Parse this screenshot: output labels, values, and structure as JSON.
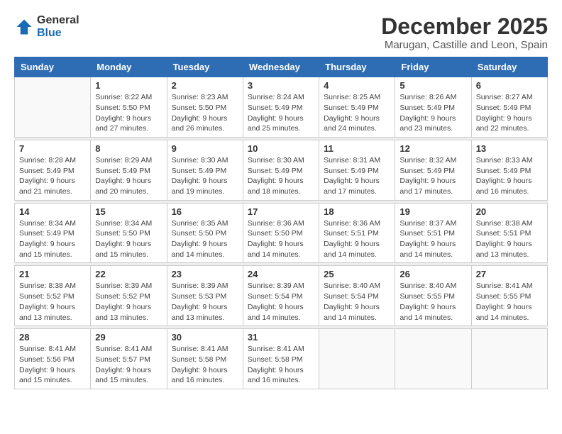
{
  "logo": {
    "general": "General",
    "blue": "Blue"
  },
  "title": "December 2025",
  "subtitle": "Marugan, Castille and Leon, Spain",
  "weekdays": [
    "Sunday",
    "Monday",
    "Tuesday",
    "Wednesday",
    "Thursday",
    "Friday",
    "Saturday"
  ],
  "weeks": [
    [
      {
        "day": "",
        "info": ""
      },
      {
        "day": "1",
        "info": "Sunrise: 8:22 AM\nSunset: 5:50 PM\nDaylight: 9 hours\nand 27 minutes."
      },
      {
        "day": "2",
        "info": "Sunrise: 8:23 AM\nSunset: 5:50 PM\nDaylight: 9 hours\nand 26 minutes."
      },
      {
        "day": "3",
        "info": "Sunrise: 8:24 AM\nSunset: 5:49 PM\nDaylight: 9 hours\nand 25 minutes."
      },
      {
        "day": "4",
        "info": "Sunrise: 8:25 AM\nSunset: 5:49 PM\nDaylight: 9 hours\nand 24 minutes."
      },
      {
        "day": "5",
        "info": "Sunrise: 8:26 AM\nSunset: 5:49 PM\nDaylight: 9 hours\nand 23 minutes."
      },
      {
        "day": "6",
        "info": "Sunrise: 8:27 AM\nSunset: 5:49 PM\nDaylight: 9 hours\nand 22 minutes."
      }
    ],
    [
      {
        "day": "7",
        "info": "Sunrise: 8:28 AM\nSunset: 5:49 PM\nDaylight: 9 hours\nand 21 minutes."
      },
      {
        "day": "8",
        "info": "Sunrise: 8:29 AM\nSunset: 5:49 PM\nDaylight: 9 hours\nand 20 minutes."
      },
      {
        "day": "9",
        "info": "Sunrise: 8:30 AM\nSunset: 5:49 PM\nDaylight: 9 hours\nand 19 minutes."
      },
      {
        "day": "10",
        "info": "Sunrise: 8:30 AM\nSunset: 5:49 PM\nDaylight: 9 hours\nand 18 minutes."
      },
      {
        "day": "11",
        "info": "Sunrise: 8:31 AM\nSunset: 5:49 PM\nDaylight: 9 hours\nand 17 minutes."
      },
      {
        "day": "12",
        "info": "Sunrise: 8:32 AM\nSunset: 5:49 PM\nDaylight: 9 hours\nand 17 minutes."
      },
      {
        "day": "13",
        "info": "Sunrise: 8:33 AM\nSunset: 5:49 PM\nDaylight: 9 hours\nand 16 minutes."
      }
    ],
    [
      {
        "day": "14",
        "info": "Sunrise: 8:34 AM\nSunset: 5:49 PM\nDaylight: 9 hours\nand 15 minutes."
      },
      {
        "day": "15",
        "info": "Sunrise: 8:34 AM\nSunset: 5:50 PM\nDaylight: 9 hours\nand 15 minutes."
      },
      {
        "day": "16",
        "info": "Sunrise: 8:35 AM\nSunset: 5:50 PM\nDaylight: 9 hours\nand 14 minutes."
      },
      {
        "day": "17",
        "info": "Sunrise: 8:36 AM\nSunset: 5:50 PM\nDaylight: 9 hours\nand 14 minutes."
      },
      {
        "day": "18",
        "info": "Sunrise: 8:36 AM\nSunset: 5:51 PM\nDaylight: 9 hours\nand 14 minutes."
      },
      {
        "day": "19",
        "info": "Sunrise: 8:37 AM\nSunset: 5:51 PM\nDaylight: 9 hours\nand 14 minutes."
      },
      {
        "day": "20",
        "info": "Sunrise: 8:38 AM\nSunset: 5:51 PM\nDaylight: 9 hours\nand 13 minutes."
      }
    ],
    [
      {
        "day": "21",
        "info": "Sunrise: 8:38 AM\nSunset: 5:52 PM\nDaylight: 9 hours\nand 13 minutes."
      },
      {
        "day": "22",
        "info": "Sunrise: 8:39 AM\nSunset: 5:52 PM\nDaylight: 9 hours\nand 13 minutes."
      },
      {
        "day": "23",
        "info": "Sunrise: 8:39 AM\nSunset: 5:53 PM\nDaylight: 9 hours\nand 13 minutes."
      },
      {
        "day": "24",
        "info": "Sunrise: 8:39 AM\nSunset: 5:54 PM\nDaylight: 9 hours\nand 14 minutes."
      },
      {
        "day": "25",
        "info": "Sunrise: 8:40 AM\nSunset: 5:54 PM\nDaylight: 9 hours\nand 14 minutes."
      },
      {
        "day": "26",
        "info": "Sunrise: 8:40 AM\nSunset: 5:55 PM\nDaylight: 9 hours\nand 14 minutes."
      },
      {
        "day": "27",
        "info": "Sunrise: 8:41 AM\nSunset: 5:55 PM\nDaylight: 9 hours\nand 14 minutes."
      }
    ],
    [
      {
        "day": "28",
        "info": "Sunrise: 8:41 AM\nSunset: 5:56 PM\nDaylight: 9 hours\nand 15 minutes."
      },
      {
        "day": "29",
        "info": "Sunrise: 8:41 AM\nSunset: 5:57 PM\nDaylight: 9 hours\nand 15 minutes."
      },
      {
        "day": "30",
        "info": "Sunrise: 8:41 AM\nSunset: 5:58 PM\nDaylight: 9 hours\nand 16 minutes."
      },
      {
        "day": "31",
        "info": "Sunrise: 8:41 AM\nSunset: 5:58 PM\nDaylight: 9 hours\nand 16 minutes."
      },
      {
        "day": "",
        "info": ""
      },
      {
        "day": "",
        "info": ""
      },
      {
        "day": "",
        "info": ""
      }
    ]
  ]
}
